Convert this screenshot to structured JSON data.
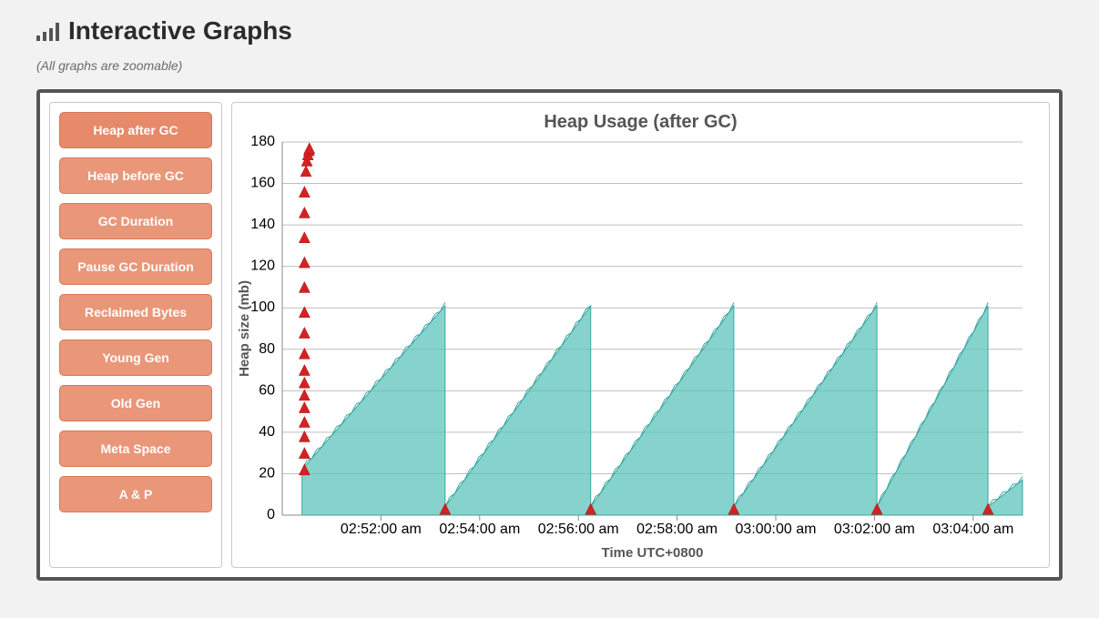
{
  "header": {
    "title": "Interactive Graphs",
    "subtitle": "(All graphs are zoomable)"
  },
  "sidebar": {
    "items": [
      {
        "label": "Heap after GC",
        "active": true
      },
      {
        "label": "Heap before GC",
        "active": false
      },
      {
        "label": "GC Duration",
        "active": false
      },
      {
        "label": "Pause GC Duration",
        "active": false
      },
      {
        "label": "Reclaimed Bytes",
        "active": false
      },
      {
        "label": "Young Gen",
        "active": false
      },
      {
        "label": "Old Gen",
        "active": false
      },
      {
        "label": "Meta Space",
        "active": false
      },
      {
        "label": "A & P",
        "active": false
      }
    ]
  },
  "chart_data": {
    "type": "area",
    "title": "Heap Usage (after GC)",
    "xlabel": "Time UTC+0800",
    "ylabel": "Heap size (mb)",
    "ylim": [
      0,
      180
    ],
    "y_ticks": [
      0,
      20,
      40,
      60,
      80,
      100,
      120,
      140,
      160,
      180
    ],
    "x_tick_labels": [
      "02:52:00 am",
      "02:54:00 am",
      "02:56:00 am",
      "02:58:00 am",
      "03:00:00 am",
      "03:02:00 am",
      "03:04:00 am"
    ],
    "x_tick_positions_min": [
      2,
      4,
      6,
      8,
      10,
      12,
      14
    ],
    "xlim_min": [
      0,
      15
    ],
    "series": [
      {
        "name": "heap-area",
        "kind": "sawtooth-area",
        "color": "#5ec4bd",
        "fill": "#5ec4bd",
        "cycles": [
          {
            "start_min": 0.4,
            "end_min": 3.3,
            "start_mb": 22,
            "peak_mb": 101
          },
          {
            "start_min": 3.3,
            "end_min": 6.25,
            "start_mb": 4,
            "peak_mb": 101
          },
          {
            "start_min": 6.25,
            "end_min": 9.15,
            "start_mb": 4,
            "peak_mb": 101
          },
          {
            "start_min": 9.15,
            "end_min": 12.05,
            "start_mb": 4,
            "peak_mb": 101
          },
          {
            "start_min": 12.05,
            "end_min": 14.3,
            "start_mb": 4,
            "peak_mb": 101
          },
          {
            "start_min": 14.3,
            "end_min": 15.0,
            "start_mb": 4,
            "peak_mb": 17
          }
        ]
      },
      {
        "name": "red-markers-initial",
        "kind": "triangle-markers",
        "color": "#d42222",
        "points": [
          {
            "x_min": 0.45,
            "y_mb": 22
          },
          {
            "x_min": 0.45,
            "y_mb": 30
          },
          {
            "x_min": 0.45,
            "y_mb": 38
          },
          {
            "x_min": 0.45,
            "y_mb": 45
          },
          {
            "x_min": 0.45,
            "y_mb": 52
          },
          {
            "x_min": 0.45,
            "y_mb": 58
          },
          {
            "x_min": 0.45,
            "y_mb": 64
          },
          {
            "x_min": 0.45,
            "y_mb": 70
          },
          {
            "x_min": 0.45,
            "y_mb": 78
          },
          {
            "x_min": 0.45,
            "y_mb": 88
          },
          {
            "x_min": 0.45,
            "y_mb": 98
          },
          {
            "x_min": 0.45,
            "y_mb": 110
          },
          {
            "x_min": 0.45,
            "y_mb": 122
          },
          {
            "x_min": 0.45,
            "y_mb": 134
          },
          {
            "x_min": 0.45,
            "y_mb": 146
          },
          {
            "x_min": 0.45,
            "y_mb": 156
          },
          {
            "x_min": 0.48,
            "y_mb": 166
          },
          {
            "x_min": 0.5,
            "y_mb": 171
          },
          {
            "x_min": 0.52,
            "y_mb": 174
          },
          {
            "x_min": 0.54,
            "y_mb": 176
          },
          {
            "x_min": 0.55,
            "y_mb": 177
          }
        ]
      },
      {
        "name": "red-markers-troughs",
        "kind": "triangle-markers",
        "color": "#d42222",
        "points": [
          {
            "x_min": 3.3,
            "y_mb": 3
          },
          {
            "x_min": 6.25,
            "y_mb": 3
          },
          {
            "x_min": 9.15,
            "y_mb": 3
          },
          {
            "x_min": 12.05,
            "y_mb": 3
          },
          {
            "x_min": 14.3,
            "y_mb": 3
          }
        ]
      }
    ],
    "colors": {
      "area": "#5ec4bd",
      "marker": "#d42222",
      "grid": "#bfbfbf",
      "axis": "#888"
    }
  }
}
